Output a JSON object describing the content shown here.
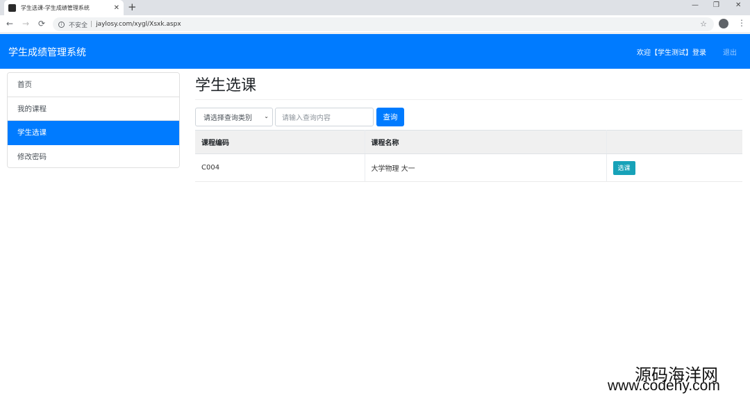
{
  "browser": {
    "tab_title": "学生选课-学生成绩管理系统",
    "close_glyph": "✕",
    "new_tab_glyph": "+",
    "window_controls": [
      "—",
      "❐",
      "✕"
    ],
    "nav_icons": [
      "←",
      "→",
      "⟳"
    ],
    "insecure_label": "不安全",
    "separator": "|",
    "url": "jaylosy.com/xygl/Xsxk.aspx",
    "bookmark_icon": "☆",
    "menu_icon": "⋮"
  },
  "navbar": {
    "brand": "学生成绩管理系统",
    "welcome": "欢迎【学生测试】登录",
    "logout": "退出",
    "color": "#007bff"
  },
  "sidebar": {
    "items": [
      {
        "label": "首页",
        "active": false
      },
      {
        "label": "我的课程",
        "active": false
      },
      {
        "label": "学生选课",
        "active": true
      },
      {
        "label": "修改密码",
        "active": false
      }
    ]
  },
  "main": {
    "title": "学生选课",
    "search": {
      "select_value": "请选择查询类别",
      "select_arrow": "⌄",
      "input_placeholder": "请输入查询内容",
      "button_label": "查询"
    },
    "table": {
      "headers": [
        "课程编码",
        "课程名称",
        ""
      ],
      "rows": [
        {
          "code": "C004",
          "name": "大学物理 大一",
          "action": "选课"
        }
      ]
    }
  },
  "watermark": {
    "line1": "源码海洋网",
    "line2": "www.codehy.com"
  }
}
